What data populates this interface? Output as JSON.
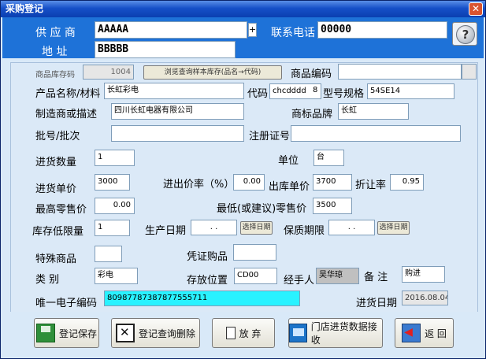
{
  "window": {
    "title": "采购登记",
    "close_icon": "close-icon"
  },
  "supplier": {
    "label": "供 应 商",
    "value": "AAAAA",
    "plus": "+"
  },
  "phone": {
    "label": "联系电话",
    "value": "00000"
  },
  "address": {
    "label": "地   址",
    "value": "BBBBB"
  },
  "stock_code": {
    "label": "商品库存码",
    "value": "1004"
  },
  "browse_button": "浏览查询样本库存(品名→代码)",
  "product_code": {
    "label": "商品编码",
    "value": ""
  },
  "product_name": {
    "label": "产品名称/材料",
    "value": "长虹彩电"
  },
  "code": {
    "label": "代码",
    "value": "chcdddd",
    "suffix": "8"
  },
  "model": {
    "label": "型号规格",
    "value": "54SE14"
  },
  "manufacturer": {
    "label": "制造商或描述",
    "value": "四川长虹电器有限公司"
  },
  "brand": {
    "label": "商标品牌",
    "value": "长虹"
  },
  "batch": {
    "label": "批号/批次",
    "value": ""
  },
  "registration": {
    "label": "注册证号",
    "value": ""
  },
  "quantity": {
    "label": "进货数量",
    "value": "1"
  },
  "unit": {
    "label": "单位",
    "value": "台"
  },
  "purchase_price": {
    "label": "进货单价",
    "value": "3000"
  },
  "markup": {
    "label": "进出价率（%）",
    "value": "0.00"
  },
  "sale_price": {
    "label": "出库单价",
    "value": "3700"
  },
  "discount": {
    "label": "折让率",
    "value": "0.95"
  },
  "max_retail": {
    "label": "最高零售价",
    "value": "0.00"
  },
  "min_retail": {
    "label": "最低(或建议)零售价",
    "value": "3500"
  },
  "stock_min": {
    "label": "库存低限量",
    "value": "1"
  },
  "production_date": {
    "label": "生产日期",
    "value": "  .  .  ",
    "button": "选择日期"
  },
  "shelf_life": {
    "label": "保质期限",
    "value": "  .  .  ",
    "button": "选择日期"
  },
  "special": {
    "label": "特殊商品",
    "value": ""
  },
  "voucher": {
    "label": "凭证购品",
    "value": ""
  },
  "category": {
    "label": "类   别",
    "value": "彩电"
  },
  "storage": {
    "label": "存放位置",
    "value": "CD00"
  },
  "handler": {
    "label": "经手人",
    "value": "吴华琼"
  },
  "note": {
    "label": "备   注",
    "value": "购进"
  },
  "barcode": {
    "label": "唯一电子编码",
    "value": "80987787387877555711"
  },
  "purchase_date": {
    "label": "进货日期",
    "value": "2016.08.04"
  },
  "buttons": {
    "save": "登记保存",
    "query_delete": "登记查询删除",
    "discard": "放 弃",
    "receive": "门店进货数据接收",
    "back": "返  回"
  }
}
